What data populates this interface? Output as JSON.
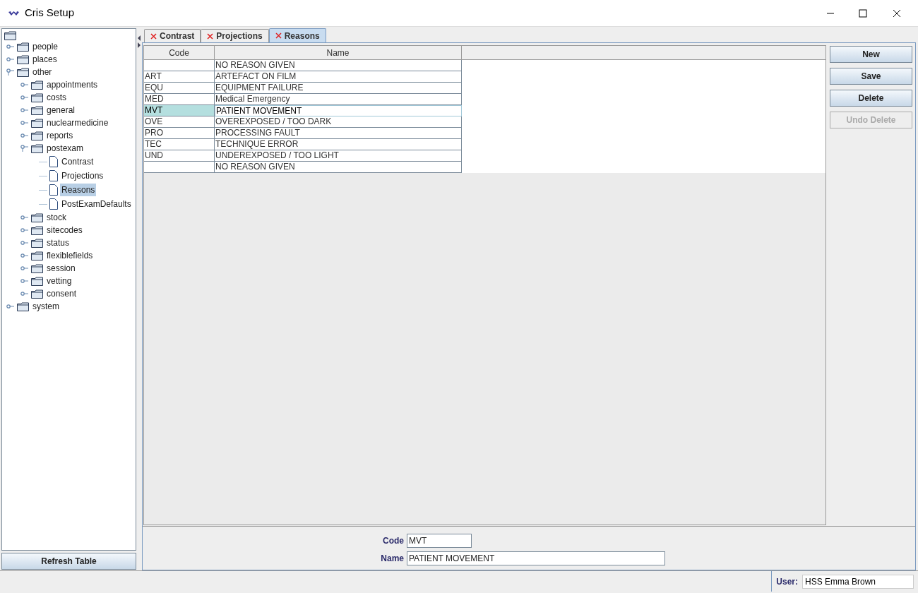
{
  "window": {
    "title": "Cris Setup"
  },
  "tree": {
    "children": [
      {
        "label": "people",
        "kind": "folder",
        "expanded": false,
        "selected": false
      },
      {
        "label": "places",
        "kind": "folder",
        "expanded": false,
        "selected": false
      },
      {
        "label": "other",
        "kind": "folder",
        "expanded": true,
        "selected": false,
        "children": [
          {
            "label": "appointments",
            "kind": "folder",
            "expanded": false,
            "selected": false
          },
          {
            "label": "costs",
            "kind": "folder",
            "expanded": false,
            "selected": false
          },
          {
            "label": "general",
            "kind": "folder",
            "expanded": false,
            "selected": false
          },
          {
            "label": "nuclearmedicine",
            "kind": "folder",
            "expanded": false,
            "selected": false
          },
          {
            "label": "reports",
            "kind": "folder",
            "expanded": false,
            "selected": false
          },
          {
            "label": "postexam",
            "kind": "folder",
            "expanded": true,
            "selected": false,
            "children": [
              {
                "label": "Contrast",
                "kind": "leaf",
                "selected": false
              },
              {
                "label": "Projections",
                "kind": "leaf",
                "selected": false
              },
              {
                "label": "Reasons",
                "kind": "leaf",
                "selected": true
              },
              {
                "label": "PostExamDefaults",
                "kind": "leaf",
                "selected": false
              }
            ]
          },
          {
            "label": "stock",
            "kind": "folder",
            "expanded": false,
            "selected": false
          },
          {
            "label": "sitecodes",
            "kind": "folder",
            "expanded": false,
            "selected": false
          },
          {
            "label": "status",
            "kind": "folder",
            "expanded": false,
            "selected": false
          },
          {
            "label": "flexiblefields",
            "kind": "folder",
            "expanded": false,
            "selected": false
          },
          {
            "label": "session",
            "kind": "folder",
            "expanded": false,
            "selected": false
          },
          {
            "label": "vetting",
            "kind": "folder",
            "expanded": false,
            "selected": false
          },
          {
            "label": "consent",
            "kind": "folder",
            "expanded": false,
            "selected": false
          }
        ]
      },
      {
        "label": "system",
        "kind": "folder",
        "expanded": false,
        "selected": false
      }
    ]
  },
  "refresh_button": "Refresh Table",
  "tabs": [
    {
      "label": "Contrast",
      "selected": false
    },
    {
      "label": "Projections",
      "selected": false
    },
    {
      "label": "Reasons",
      "selected": true
    }
  ],
  "table": {
    "columns": [
      "Code",
      "Name"
    ],
    "rows": [
      {
        "code": "",
        "name": "NO REASON GIVEN",
        "selected": false
      },
      {
        "code": "ART",
        "name": "ARTEFACT ON FILM",
        "selected": false
      },
      {
        "code": "EQU",
        "name": "EQUIPMENT FAILURE",
        "selected": false
      },
      {
        "code": "MED",
        "name": "Medical Emergency",
        "selected": false
      },
      {
        "code": "MVT",
        "name": "PATIENT MOVEMENT",
        "selected": true
      },
      {
        "code": "OVE",
        "name": "OVEREXPOSED / TOO DARK",
        "selected": false
      },
      {
        "code": "PRO",
        "name": "PROCESSING FAULT",
        "selected": false
      },
      {
        "code": "TEC",
        "name": "TECHNIQUE ERROR",
        "selected": false
      },
      {
        "code": "UND",
        "name": "UNDEREXPOSED / TOO LIGHT",
        "selected": false
      },
      {
        "code": "",
        "name": "NO REASON GIVEN",
        "selected": false
      }
    ]
  },
  "buttons": [
    {
      "label": "New",
      "disabled": false
    },
    {
      "label": "Save",
      "disabled": false
    },
    {
      "label": "Delete",
      "disabled": false
    },
    {
      "label": "Undo Delete",
      "disabled": true
    }
  ],
  "form": [
    {
      "label": "Code",
      "value": "MVT"
    },
    {
      "label": "Name",
      "value": "PATIENT MOVEMENT"
    }
  ],
  "status_bar": {
    "label": "User:",
    "value": "HSS Emma Brown"
  }
}
